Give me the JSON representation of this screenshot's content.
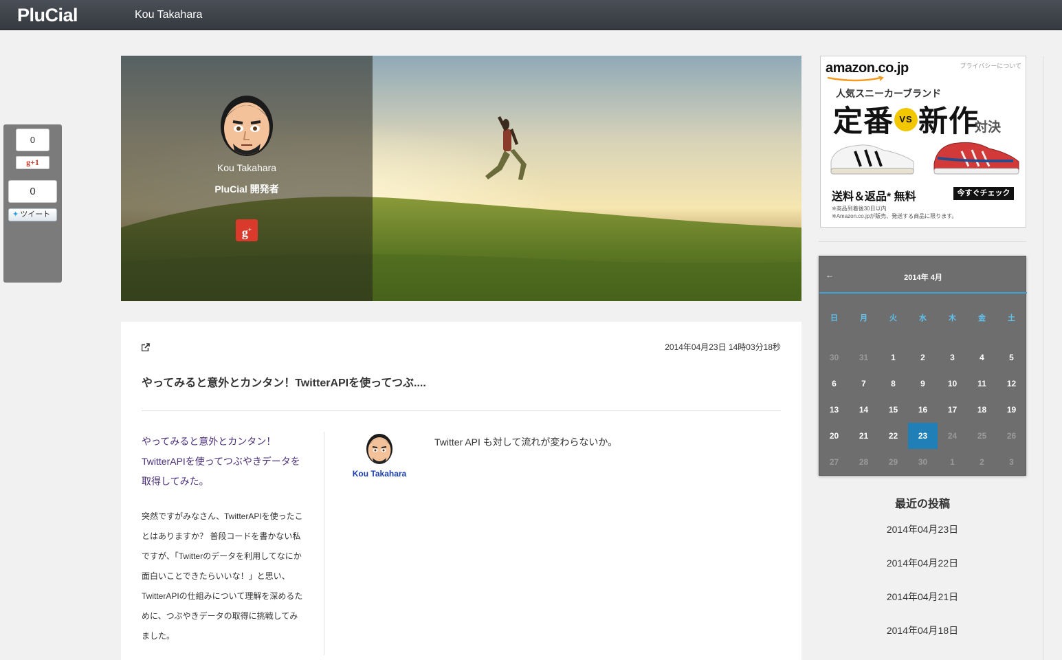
{
  "topbar": {
    "logo": "PluCial",
    "user_name": "Kou Takahara"
  },
  "social": {
    "gplus_count": "0",
    "gplus_label": "g+1",
    "tweet_count": "0",
    "tweet_label": "ツイート"
  },
  "profile": {
    "name": "Kou Takahara",
    "role": "PluCial 開発者"
  },
  "post": {
    "date": "2014年04月23日 14時03分18秒",
    "title": "やってみると意外とカンタン！TwitterAPIを使ってつぶ....",
    "heading": "やってみると意外とカンタン！TwitterAPIを使ってつぶやきデータを取得してみた。",
    "body": "突然ですがみなさん、TwitterAPIを使ったことはありますか？ 普段コードを書かない私ですが、「Twitterのデータを利用してなにか面白いことできたらいいな！」と思い、TwitterAPIの仕組みについて理解を深めるために、つぶやきデータの取得に挑戦してみました。",
    "comment_author": "Kou Takahara",
    "comment_text": "Twitter API も対して流れが変わらないか。"
  },
  "ad": {
    "brand": "amazon.co.jp",
    "privacy": "プライバシーについて",
    "subtitle": "人気スニーカーブランド",
    "big_left": "定番",
    "vs": "VS",
    "big_right": "新作",
    "small": "対決",
    "shipping": "送料＆返品* 無料",
    "cta": "今すぐチェック",
    "note1": "※商品到着後30日以内",
    "note2": "※Amazon.co.jpが販売、発送する商品に限ります。"
  },
  "calendar": {
    "prev": "←",
    "title": "2014年 4月",
    "weekdays": [
      "日",
      "月",
      "火",
      "水",
      "木",
      "金",
      "土"
    ],
    "weeks": [
      [
        "30",
        "31",
        "1",
        "2",
        "3",
        "4",
        "5"
      ],
      [
        "6",
        "7",
        "8",
        "9",
        "10",
        "11",
        "12"
      ],
      [
        "13",
        "14",
        "15",
        "16",
        "17",
        "18",
        "19"
      ],
      [
        "20",
        "21",
        "22",
        "23",
        "24",
        "25",
        "26"
      ],
      [
        "27",
        "28",
        "29",
        "30",
        "1",
        "2",
        "3"
      ]
    ],
    "muted": [
      [
        true,
        true,
        false,
        false,
        false,
        false,
        false
      ],
      [
        false,
        false,
        false,
        false,
        false,
        false,
        false
      ],
      [
        false,
        false,
        false,
        false,
        false,
        false,
        false
      ],
      [
        false,
        false,
        false,
        false,
        true,
        true,
        true
      ],
      [
        true,
        true,
        true,
        true,
        true,
        true,
        true
      ]
    ],
    "selected_day": "23",
    "accent_color": "#3aa3d8"
  },
  "recent": {
    "title": "最近の投稿",
    "items": [
      "2014年04月23日",
      "2014年04月22日",
      "2014年04月21日",
      "2014年04月18日"
    ]
  }
}
